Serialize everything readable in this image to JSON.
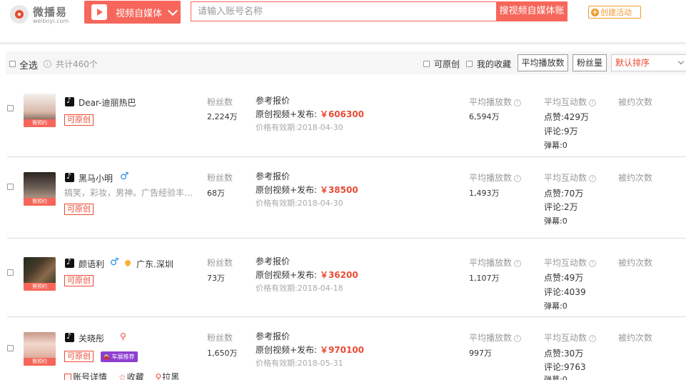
{
  "header": {
    "logo_text": "微播易",
    "logo_sub": "weiboyi.com",
    "media_label": "视频自媒体",
    "search_placeholder": "请输入账号名称",
    "search_button": "搜视频自媒体账",
    "create_button": "创建活动"
  },
  "toolbar": {
    "select_all": "全选",
    "total": "共计460个",
    "original": "可原创",
    "favorites": "我的收藏",
    "avg_play_btn": "平均播放数",
    "fans_btn": "粉丝量",
    "sort_selected": "默认排序"
  },
  "labels": {
    "fans": "粉丝数",
    "price_title": "参考报价",
    "price_prefix": "原创视频+发布:",
    "validity_prefix": "价格有效期:",
    "avg_play": "平均播放数",
    "avg_interact": "平均互动数",
    "booked": "被约次数",
    "badge": "需预约",
    "original": "可原创",
    "likes_prefix": "点赞:",
    "comments_prefix": "评论:",
    "danmu_prefix": "弹幕:",
    "car_tag": "车展推荐"
  },
  "rows": [
    {
      "name": "Dear-迪丽热巴",
      "fans": "2,224万",
      "price": "￥606300",
      "validity": "2018-04-30",
      "avg_play": "6,594万",
      "likes": "429万",
      "comments": "9万",
      "danmu": "0",
      "avatar_color": "#d8b8a8"
    },
    {
      "name": "黑马小明",
      "desc": "搞笑，彩妆，男神。广告经验丰…",
      "fans": "68万",
      "price": "￥38500",
      "validity": "2018-04-30",
      "avg_play": "1,493万",
      "likes": "70万",
      "comments": "2万",
      "danmu": "0",
      "avatar_color": "#6b5e55"
    },
    {
      "name": "颜语利",
      "location": "广东.深圳",
      "fans": "73万",
      "price": "￥36200",
      "validity": "2018-04-18",
      "avg_play": "1,107万",
      "likes": "49万",
      "comments": "4039",
      "danmu": "0",
      "avatar_color": "#4a3a2a"
    },
    {
      "name": "关晓彤",
      "fans": "1,650万",
      "price": "￥970100",
      "validity": "2018-05-31",
      "avg_play": "997万",
      "likes": "30万",
      "comments": "9763",
      "danmu": "0",
      "avatar_color": "#e8c0b0"
    }
  ],
  "row4_links": {
    "detail": "账号详情",
    "fav": "收藏",
    "block": "拉黑"
  }
}
